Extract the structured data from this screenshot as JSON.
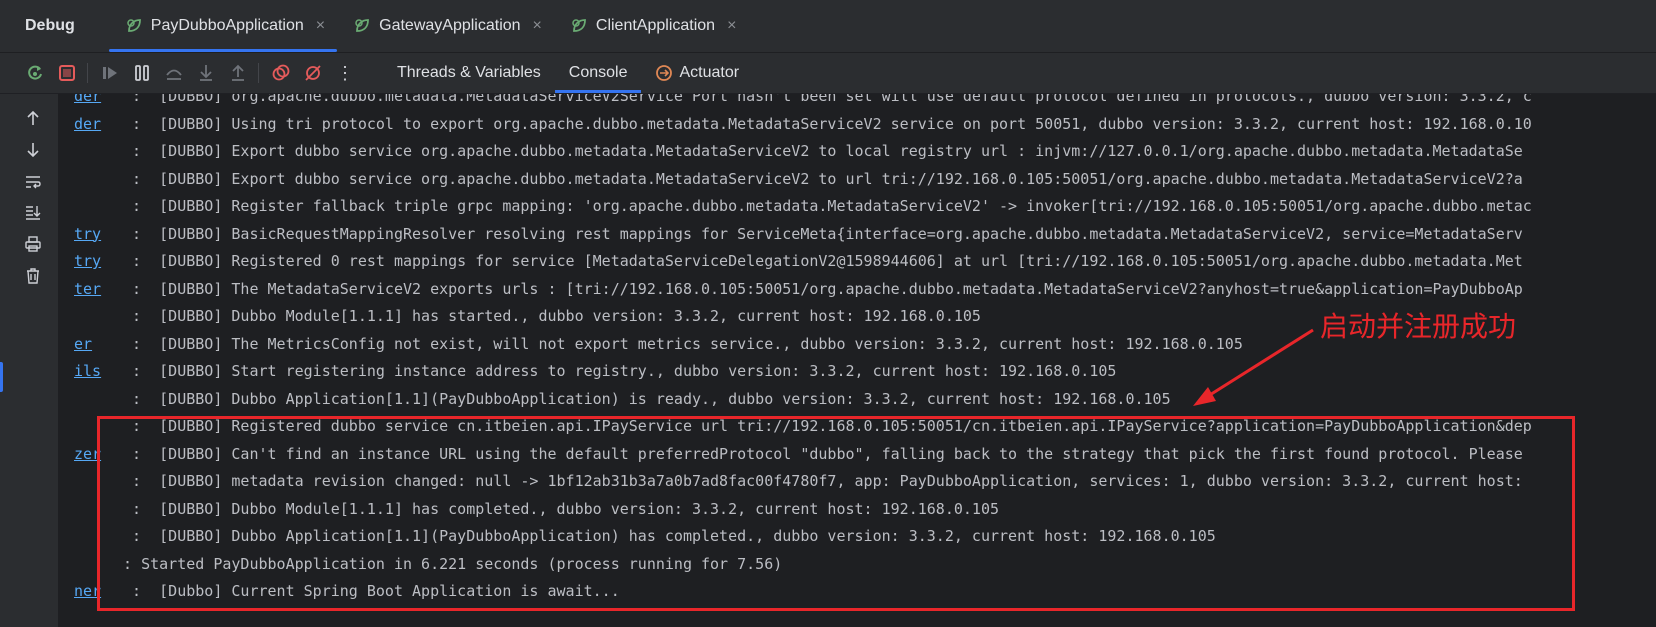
{
  "header": {
    "debug_label": "Debug",
    "tabs": [
      {
        "label": "PayDubboApplication",
        "active": true
      },
      {
        "label": "GatewayApplication",
        "active": false
      },
      {
        "label": "ClientApplication",
        "active": false
      }
    ],
    "close_glyph": "×"
  },
  "toolbar": {
    "icons": [
      "rerun-icon",
      "stop-icon",
      "resume-icon",
      "pause-icon",
      "step-over-icon",
      "step-into-icon",
      "step-out-icon",
      "view-breakpoints-icon",
      "mute-breakpoints-icon",
      "more-icon"
    ],
    "more_glyph": "⋮",
    "subtabs": [
      {
        "label": "Threads & Variables",
        "active": false
      },
      {
        "label": "Console",
        "active": true
      },
      {
        "label": "Actuator",
        "active": false
      }
    ]
  },
  "gutter_icons": [
    "arrow-up-icon",
    "arrow-down-icon",
    "soft-wrap-icon",
    "scroll-to-end-icon",
    "print-icon",
    "trash-icon"
  ],
  "console": {
    "lines": [
      {
        "src": "der",
        "text": "  :  [DUBBO] org.apache.dubbo.metadata.MetadataServiceV2Service Port hasn't been set will use default protocol defined in protocols., dubbo version: 3.3.2, c"
      },
      {
        "src": "der",
        "text": "  :  [DUBBO] Using tri protocol to export org.apache.dubbo.metadata.MetadataServiceV2 service on port 50051, dubbo version: 3.3.2, current host: 192.168.0.10"
      },
      {
        "src": "",
        "text": "  :  [DUBBO] Export dubbo service org.apache.dubbo.metadata.MetadataServiceV2 to local registry url : injvm://127.0.0.1/org.apache.dubbo.metadata.MetadataSe"
      },
      {
        "src": "",
        "text": "  :  [DUBBO] Export dubbo service org.apache.dubbo.metadata.MetadataServiceV2 to url tri://192.168.0.105:50051/org.apache.dubbo.metadata.MetadataServiceV2?a"
      },
      {
        "src": "",
        "text": "  :  [DUBBO] Register fallback triple grpc mapping: 'org.apache.dubbo.metadata.MetadataServiceV2' -> invoker[tri://192.168.0.105:50051/org.apache.dubbo.metac"
      },
      {
        "src": "try",
        "text": "  :  [DUBBO] BasicRequestMappingResolver resolving rest mappings for ServiceMeta{interface=org.apache.dubbo.metadata.MetadataServiceV2, service=MetadataServ"
      },
      {
        "src": "try",
        "text": "  :  [DUBBO] Registered 0 rest mappings for service [MetadataServiceDelegationV2@1598944606] at url [tri://192.168.0.105:50051/org.apache.dubbo.metadata.Met"
      },
      {
        "src": "ter",
        "text": "  :  [DUBBO] The MetadataServiceV2 exports urls : [tri://192.168.0.105:50051/org.apache.dubbo.metadata.MetadataServiceV2?anyhost=true&application=PayDubboAp"
      },
      {
        "src": "",
        "text": "  :  [DUBBO] Dubbo Module[1.1.1] has started., dubbo version: 3.3.2, current host: 192.168.0.105"
      },
      {
        "src": "er",
        "text": "  :  [DUBBO] The MetricsConfig not exist, will not export metrics service., dubbo version: 3.3.2, current host: 192.168.0.105"
      },
      {
        "src": "ils",
        "text": "  :  [DUBBO] Start registering instance address to registry., dubbo version: 3.3.2, current host: 192.168.0.105"
      },
      {
        "src": "",
        "text": "  :  [DUBBO] Dubbo Application[1.1](PayDubboApplication) is ready., dubbo version: 3.3.2, current host: 192.168.0.105"
      },
      {
        "src": "",
        "text": "  :  [DUBBO] Registered dubbo service cn.itbeien.api.IPayService url tri://192.168.0.105:50051/cn.itbeien.api.IPayService?application=PayDubboApplication&dep"
      },
      {
        "src": "zer",
        "text": "  :  [DUBBO] Can't find an instance URL using the default preferredProtocol \"dubbo\", falling back to the strategy that pick the first found protocol. Please"
      },
      {
        "src": "",
        "text": "  :  [DUBBO] metadata revision changed: null -> 1bf12ab31b3a7a0b7ad8fac00f4780f7, app: PayDubboApplication, services: 1, dubbo version: 3.3.2, current host:"
      },
      {
        "src": "",
        "text": "  :  [DUBBO] Dubbo Module[1.1.1] has completed., dubbo version: 3.3.2, current host: 192.168.0.105"
      },
      {
        "src": "",
        "text": "  :  [DUBBO] Dubbo Application[1.1](PayDubboApplication) has completed., dubbo version: 3.3.2, current host: 192.168.0.105"
      },
      {
        "src": "",
        "text": " : Started PayDubboApplication in 6.221 seconds (process running for 7.56)"
      },
      {
        "src": "ner",
        "text": "  :  [Dubbo] Current Spring Boot Application is await..."
      }
    ]
  },
  "annotation": {
    "text": "启动并注册成功",
    "color": "#e8262a"
  }
}
